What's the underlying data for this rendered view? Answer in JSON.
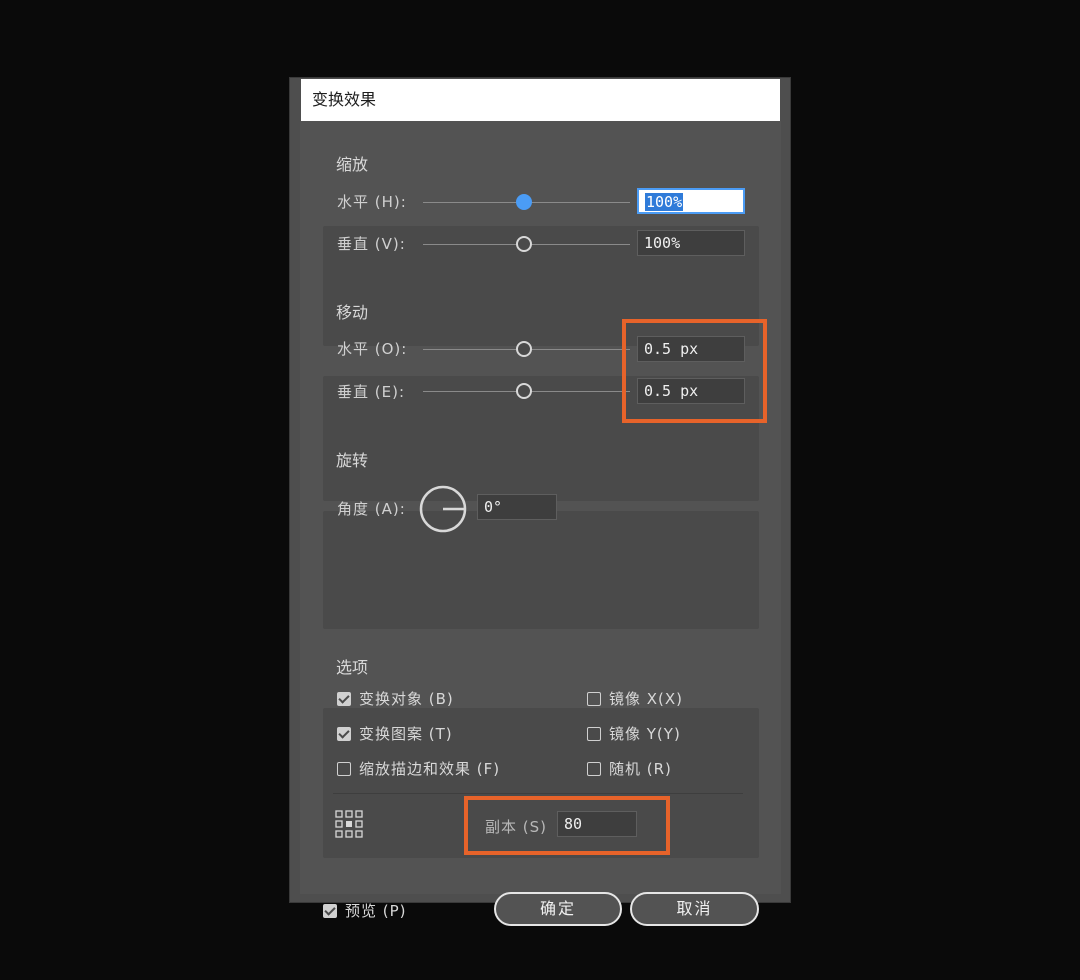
{
  "dialog": {
    "title": "变换效果"
  },
  "scale": {
    "section_label": "缩放",
    "horizontal_label": "水平 (H):",
    "horizontal_value": "100%",
    "vertical_label": "垂直 (V):",
    "vertical_value": "100%"
  },
  "move": {
    "section_label": "移动",
    "horizontal_label": "水平 (O):",
    "horizontal_value": "0.5 px",
    "vertical_label": "垂直 (E):",
    "vertical_value": "0.5 px"
  },
  "rotate": {
    "section_label": "旋转",
    "angle_label": "角度 (A):",
    "angle_value": "0°"
  },
  "options": {
    "section_label": "选项",
    "transform_objects": {
      "label": "变换对象 (B)",
      "checked": true
    },
    "transform_patterns": {
      "label": "变换图案 (T)",
      "checked": true
    },
    "scale_strokes": {
      "label": "缩放描边和效果 (F)",
      "checked": false
    },
    "reflect_x": {
      "label": "镜像 X(X)",
      "checked": false
    },
    "reflect_y": {
      "label": "镜像 Y(Y)",
      "checked": false
    },
    "random": {
      "label": "随机 (R)",
      "checked": false
    },
    "copies_label": "副本 (S)",
    "copies_value": "80"
  },
  "footer": {
    "preview_label": "预览 (P)",
    "preview_checked": true,
    "ok_label": "确定",
    "cancel_label": "取消"
  },
  "colors": {
    "highlight": "#e7632a",
    "accent": "#4b9cf5"
  }
}
